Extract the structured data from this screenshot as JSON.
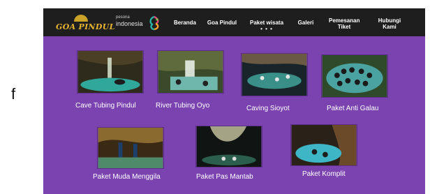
{
  "stray_char": "f",
  "brand": {
    "logo_text": "GOA PINDUL",
    "partner_small": "pesona",
    "partner_big": "indonesia"
  },
  "nav": [
    {
      "label": "Beranda"
    },
    {
      "label": "Goa Pindul"
    },
    {
      "label": "Paket wisata",
      "sub": "• • •"
    },
    {
      "label": "Galeri"
    },
    {
      "label": "Pemesanan Tiket"
    },
    {
      "label": "Hubungi Kami"
    }
  ],
  "packages": [
    {
      "label": "Cave Tubing Pindul"
    },
    {
      "label": "River Tubing Oyo"
    },
    {
      "label": "Caving Sioyot"
    },
    {
      "label": "Paket Anti Galau"
    },
    {
      "label": "Paket Muda Menggila"
    },
    {
      "label": "Paket Pas Mantab"
    },
    {
      "label": "Paket Komplit"
    }
  ],
  "colors": {
    "content_bg": "#7a43b0",
    "navbar_bg": "#1e1e1e",
    "logo_gold": "#e8b531",
    "nav_text": "#ffffff"
  }
}
